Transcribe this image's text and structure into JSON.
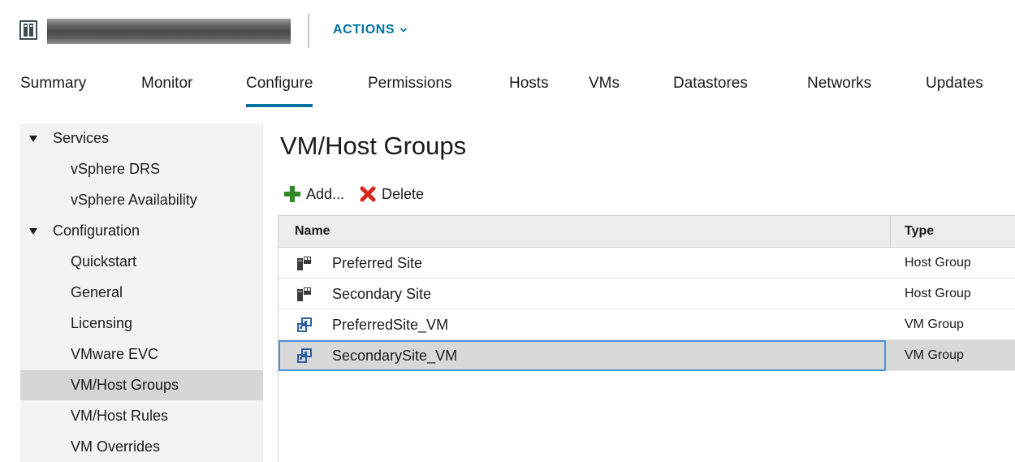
{
  "header": {
    "actions_label": "ACTIONS"
  },
  "tabs": [
    {
      "label": "Summary"
    },
    {
      "label": "Monitor"
    },
    {
      "label": "Configure",
      "active": true
    },
    {
      "label": "Permissions"
    },
    {
      "label": "Hosts"
    },
    {
      "label": "VMs"
    },
    {
      "label": "Datastores"
    },
    {
      "label": "Networks"
    },
    {
      "label": "Updates"
    }
  ],
  "sidebar": {
    "groups": [
      {
        "label": "Services",
        "items": [
          "vSphere DRS",
          "vSphere Availability"
        ]
      },
      {
        "label": "Configuration",
        "items": [
          "Quickstart",
          "General",
          "Licensing",
          "VMware EVC",
          "VM/Host Groups",
          "VM/Host Rules",
          "VM Overrides"
        ]
      }
    ],
    "selected_item": "VM/Host Groups"
  },
  "main": {
    "title": "VM/Host Groups",
    "toolbar": {
      "add_label": "Add...",
      "delete_label": "Delete"
    },
    "table": {
      "columns": [
        "Name",
        "Type"
      ],
      "rows": [
        {
          "name": "Preferred Site",
          "type": "Host Group",
          "icon": "host-group-icon"
        },
        {
          "name": "Secondary Site",
          "type": "Host Group",
          "icon": "host-group-icon"
        },
        {
          "name": "PreferredSite_VM",
          "type": "VM Group",
          "icon": "vm-group-icon"
        },
        {
          "name": "SecondarySite_VM",
          "type": "VM Group",
          "icon": "vm-group-icon",
          "selected": true
        }
      ]
    }
  },
  "colors": {
    "accent": "#0072a3",
    "add_icon": "#2e8b22",
    "delete_icon": "#d9261c",
    "selection_border": "#4a90d9"
  }
}
